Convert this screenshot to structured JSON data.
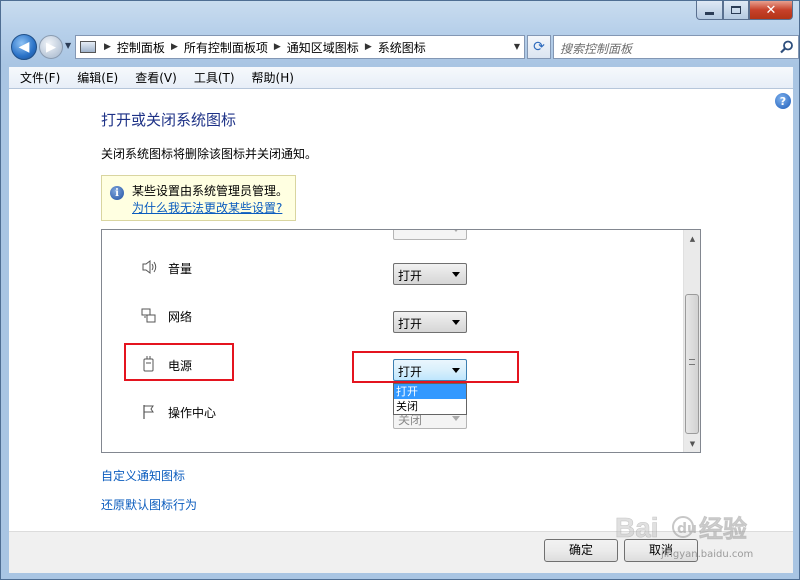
{
  "nav": {
    "breadcrumbs": [
      "控制面板",
      "所有控制面板项",
      "通知区域图标",
      "系统图标"
    ],
    "search_placeholder": "搜索控制面板"
  },
  "menubar": {
    "items": [
      "文件(F)",
      "编辑(E)",
      "查看(V)",
      "工具(T)",
      "帮助(H)"
    ]
  },
  "page": {
    "title": "打开或关闭系统图标",
    "description": "关闭系统图标将删除该图标并关闭通知。",
    "info_text": "某些设置由系统管理员管理。",
    "info_link": "为什么我无法更改某些设置?"
  },
  "list": {
    "rows": [
      {
        "label": "音量",
        "value": "打开",
        "icon": "speaker-icon"
      },
      {
        "label": "网络",
        "value": "打开",
        "icon": "network-icon"
      },
      {
        "label": "电源",
        "value": "打开",
        "icon": "power-icon"
      },
      {
        "label": "操作中心",
        "value": "关闭",
        "icon": "flag-icon"
      }
    ],
    "dropdown_options": [
      "打开",
      "关闭"
    ],
    "dropdown_selected": "打开"
  },
  "links": {
    "customize": "自定义通知图标",
    "restore": "还原默认图标行为"
  },
  "buttons": {
    "ok": "确定",
    "cancel": "取消"
  },
  "watermark": {
    "text": "Baidu经验",
    "sub": "jingyan.baidu.com"
  },
  "colors": {
    "title": "#1e3287",
    "link": "#0b5cbe",
    "highlight": "#e4141f",
    "selection": "#3399ff",
    "info_bg": "#ffffe1"
  }
}
